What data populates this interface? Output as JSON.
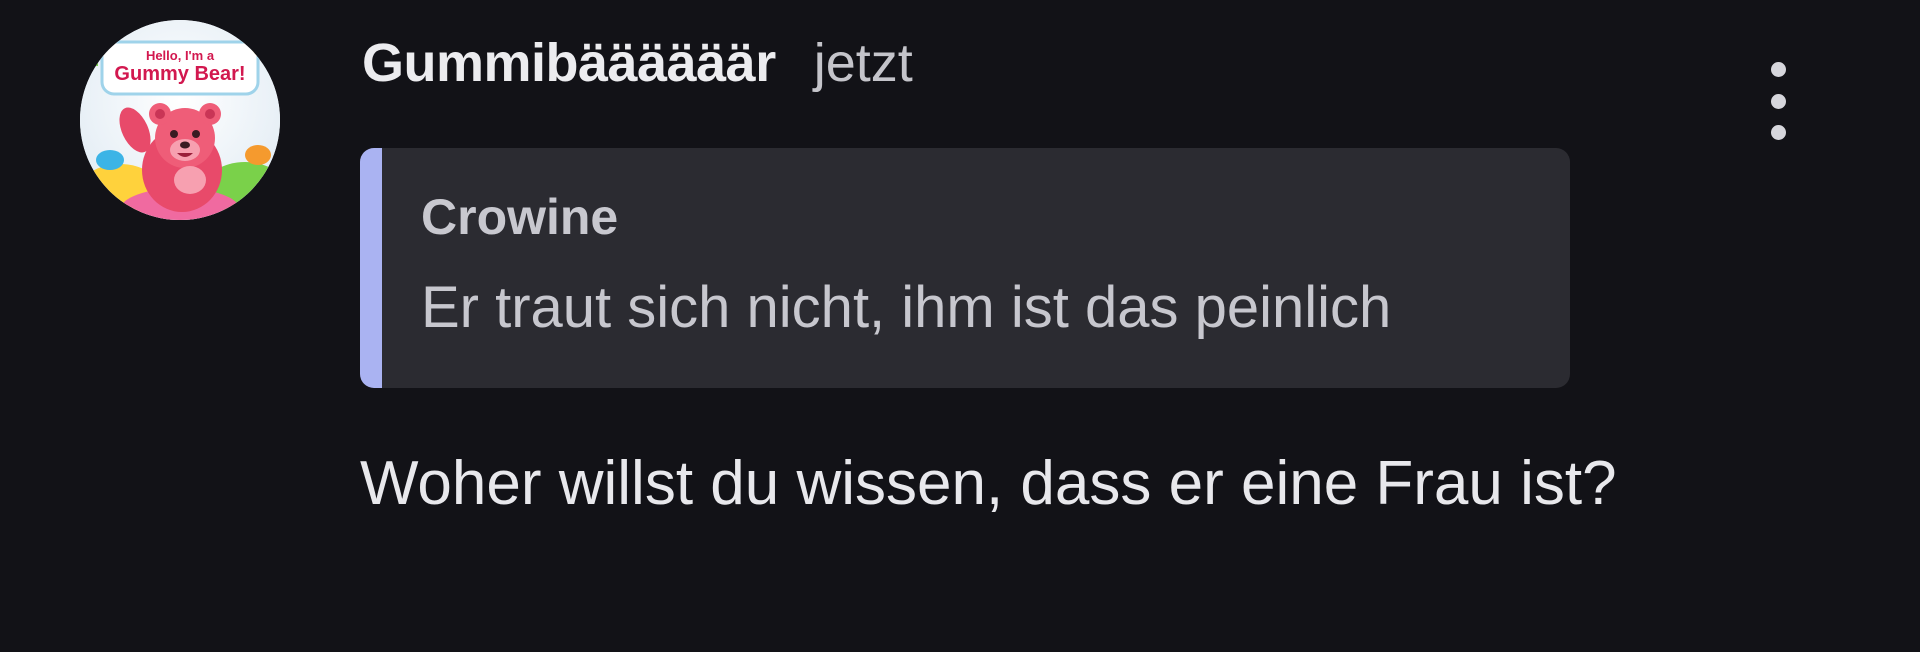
{
  "comment": {
    "avatar": {
      "icon": "gummy-bear-avatar",
      "logo_line1": "Hello, I'm a",
      "logo_line2": "Gummy Bear!"
    },
    "author": "Gummibäääääär",
    "timestamp": "jetzt",
    "menu_icon": "more-vertical-icon",
    "quote": {
      "author": "Crowine",
      "text": "Er traut sich nicht, ihm ist das peinlich",
      "accent_color": "#aab3f2"
    },
    "message": "Woher willst du wissen, dass er eine Frau ist?"
  },
  "colors": {
    "background": "#121217",
    "quote_background": "#2b2b31",
    "text_primary": "#e8e8ec"
  }
}
